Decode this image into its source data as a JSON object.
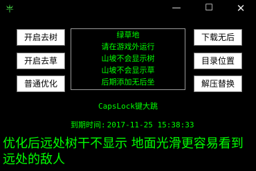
{
  "window": {
    "icon": "cannabis-leaf-icon",
    "minimize_glyph": "—",
    "maximize_glyph": "☐",
    "close_glyph": "✕"
  },
  "left_buttons": [
    "开启去树",
    "开启去草",
    "普通优化"
  ],
  "right_buttons": [
    "下载无后",
    "目录位置",
    "解压替换"
  ],
  "panel": {
    "lines": [
      "绿草地",
      "请在游戏外运行",
      "山坡不会显示树",
      "山坡不会显示草",
      "后期添加无后坐"
    ]
  },
  "hotkey_text": "CapsLock键大跳",
  "expiry": {
    "label": "到期时间:",
    "value": "2017-11-25 15:38:33"
  },
  "notice_text": "优化后远处树干不显示 地面光滑更容易看到远处的敌人",
  "colors": {
    "background": "#000000",
    "text_green": "#00ff00",
    "button_bg": "#ffffff",
    "leaf_green": "#3fbf3f"
  }
}
